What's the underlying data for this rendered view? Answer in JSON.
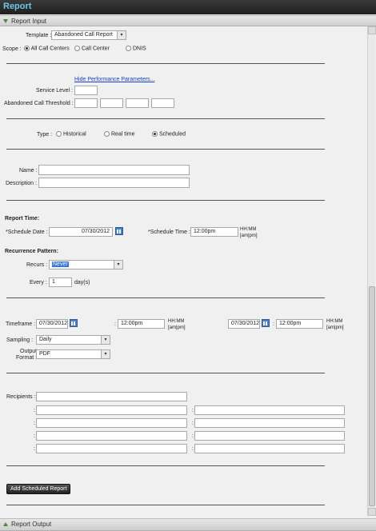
{
  "title": "Report",
  "report_input": {
    "label": "Report Input"
  },
  "report_output": {
    "label": "Report Output"
  },
  "template": {
    "label": "Template :",
    "value": "Abandoned Call Report"
  },
  "scope": {
    "label": "Scope :",
    "options": [
      "All Call Centers",
      "Call Center",
      "DNIS"
    ],
    "selected": "All Call Centers"
  },
  "performance": {
    "hide_link": "Hide Performance Parameters...",
    "service_level_label": "Service Level :",
    "threshold_label": "Abandoned Call Threshold :"
  },
  "type": {
    "label": "Type :",
    "options": [
      "Historical",
      "Real time",
      "Scheduled"
    ],
    "selected": "Scheduled"
  },
  "name_label": "Name :",
  "description_label": "Description :",
  "report_time": {
    "heading": "Report Time:",
    "schedule_date_label": "*Schedule Date :",
    "schedule_date": "07/30/2012",
    "schedule_time_label": "*Schedule Time :",
    "schedule_time": "12:00pm",
    "time_hint_1": "HH:MM",
    "time_hint_2": "[am|pm]"
  },
  "recurrence": {
    "heading": "Recurrence Pattern:",
    "recurs_label": "Recurs :",
    "recurs_value": "Never",
    "every_label": "Every :",
    "every_value": "1",
    "every_unit": "day(s)"
  },
  "timeframe": {
    "label": "Timeframe :",
    "start_date": "07/30/2012",
    "start_time": "12:00pm",
    "end_date": "07/30/2012",
    "end_time": "12:00pm",
    "colon": ":",
    "hint_1": "HH:MM",
    "hint_2": "[am|pm]"
  },
  "sampling": {
    "label": "Sampling :",
    "value": "Daily"
  },
  "output_format": {
    "label_1": "Output",
    "label_2": "Format :",
    "value": "PDF"
  },
  "recipients": {
    "label": "Recipients :",
    "colon": ":"
  },
  "add_button": "Add Scheduled Report"
}
